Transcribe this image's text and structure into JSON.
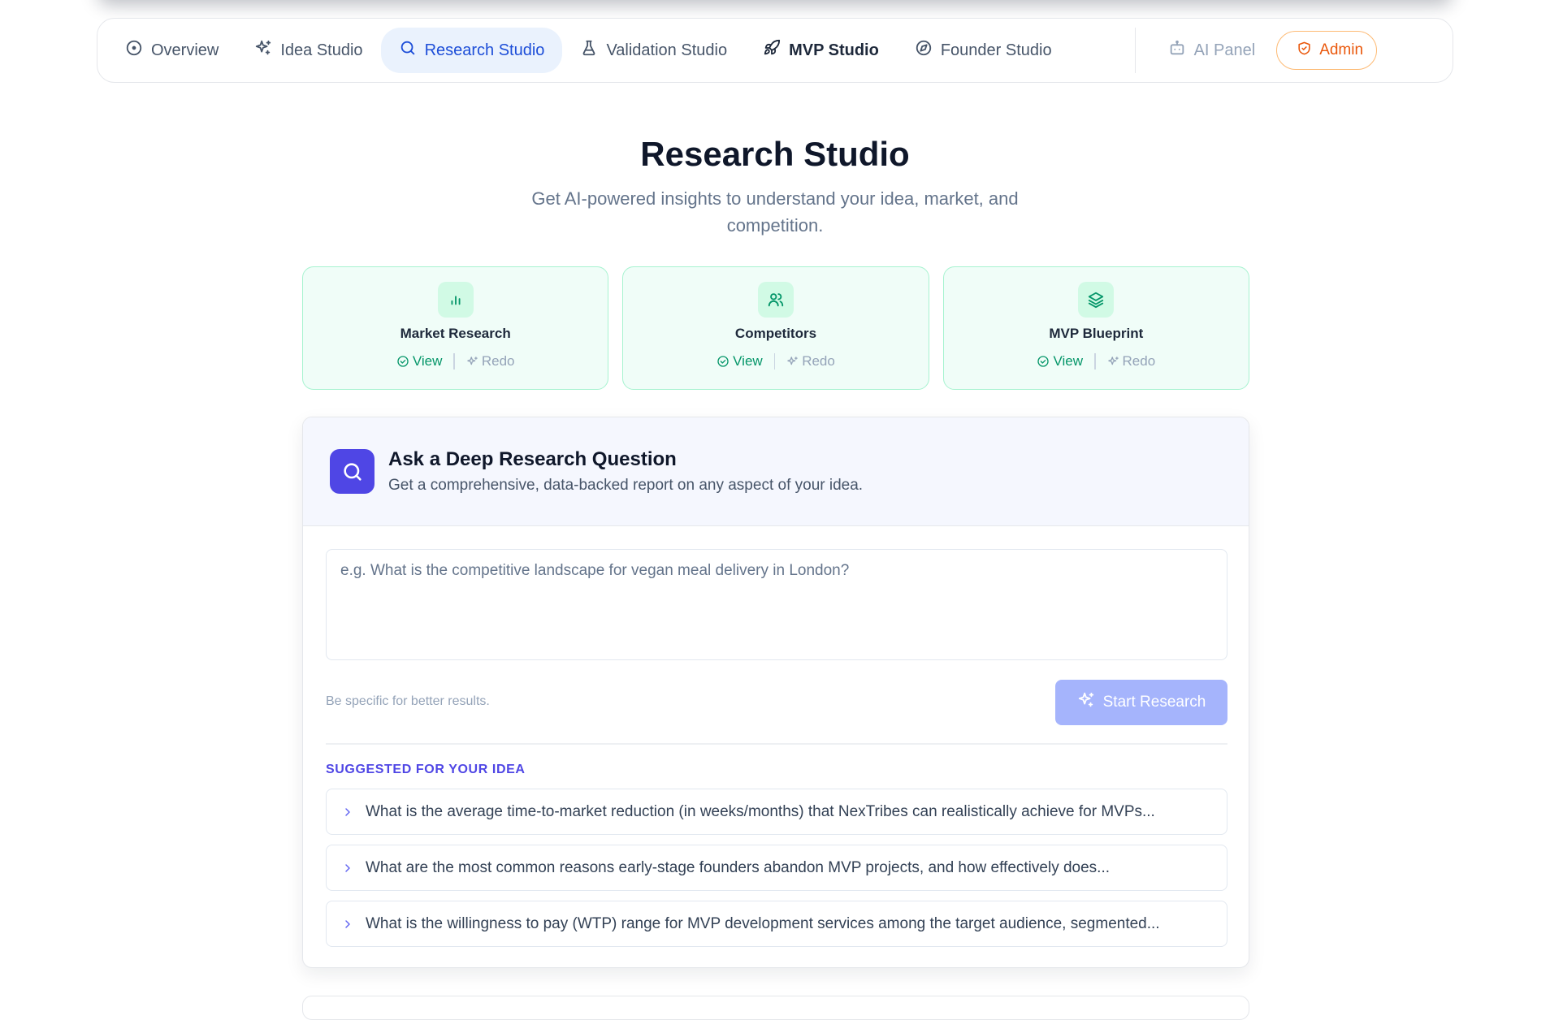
{
  "nav": {
    "items": [
      {
        "label": "Overview",
        "icon": "compass-circle-icon"
      },
      {
        "label": "Idea Studio",
        "icon": "sparkles-icon"
      },
      {
        "label": "Research Studio",
        "icon": "search-icon",
        "active": true
      },
      {
        "label": "Validation Studio",
        "icon": "flask-icon"
      },
      {
        "label": "MVP Studio",
        "icon": "rocket-icon"
      },
      {
        "label": "Founder Studio",
        "icon": "compass-icon"
      }
    ],
    "ai_panel": {
      "label": "AI Panel",
      "icon": "bot-icon"
    },
    "admin": {
      "label": "Admin",
      "icon": "shield-icon"
    }
  },
  "header": {
    "title": "Research Studio",
    "subtitle": "Get AI-powered insights to understand your idea, market, and competition."
  },
  "cards": [
    {
      "title": "Market Research",
      "icon": "bar-chart-icon",
      "view_label": "View",
      "redo_label": "Redo"
    },
    {
      "title": "Competitors",
      "icon": "users-icon",
      "view_label": "View",
      "redo_label": "Redo"
    },
    {
      "title": "MVP Blueprint",
      "icon": "layers-icon",
      "view_label": "View",
      "redo_label": "Redo"
    }
  ],
  "research": {
    "title": "Ask a Deep Research Question",
    "subtitle": "Get a comprehensive, data-backed report on any aspect of your idea.",
    "placeholder": "e.g. What is the competitive landscape for vegan meal delivery in London?",
    "value": "",
    "hint": "Be specific for better results.",
    "start_label": "Start Research",
    "suggested_heading": "SUGGESTED FOR YOUR IDEA",
    "suggestions": [
      "What is the average time-to-market reduction (in weeks/months) that NexTribes can realistically achieve for MVPs...",
      "What are the most common reasons early-stage founders abandon MVP projects, and how effectively does...",
      "What is the willingness to pay (WTP) range for MVP development services among the target audience, segmented..."
    ]
  },
  "colors": {
    "accent": "#4f46e5",
    "active_nav_text": "#1d4ed8",
    "active_nav_bg": "#eaf2fd",
    "success": "#059669",
    "admin": "#ea580c"
  }
}
